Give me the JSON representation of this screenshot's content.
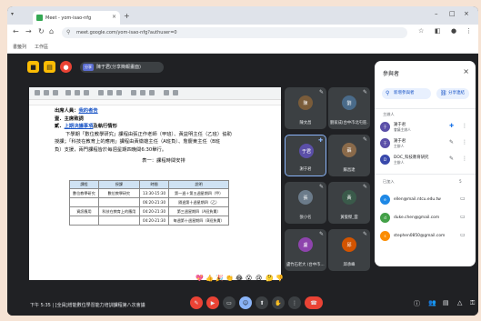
{
  "browser": {
    "tab_title": "Meet - yom-isao-nfg",
    "tab_close": "×",
    "new_tab": "+",
    "url": "meet.google.com/yom-isao-nfg?authuser=0",
    "bookmarks": [
      "書籤列",
      "工作區"
    ],
    "window_controls": [
      "–",
      "□",
      "×"
    ]
  },
  "meet": {
    "presenter_label": "陳于君(分享簡報畫面)",
    "presenter_tag": "分享",
    "bottom_info": "下午 5:35 | [全員]增能數位學習能力培訓課程第八次會議",
    "reactions": [
      "💖",
      "👍",
      "🎉",
      "👏",
      "😂",
      "😮",
      "😢",
      "🤔",
      "👎"
    ],
    "tiles": [
      {
        "name": "陳文昌",
        "initial": "陳",
        "color": "#7a5c3a"
      },
      {
        "name": "劉家成(台中市北屯區…)",
        "initial": "劉",
        "color": "#4a6b8a"
      },
      {
        "name": "謝于君",
        "initial": "于君",
        "color": "#5b4fa8"
      },
      {
        "name": "蘇昌達",
        "initial": "蘇",
        "color": "#8a6a4a"
      },
      {
        "name": "張小名",
        "initial": "張",
        "color": "#6b7b8a"
      },
      {
        "name": "黃俊傑_雲",
        "initial": "黃",
        "color": "#3a5a4a"
      },
      {
        "name": "盧竹石老大 (台中市…)",
        "initial": "盧",
        "color": "#8e44ad"
      },
      {
        "name": "邱承峰",
        "initial": "邱",
        "color": "#d35400"
      }
    ]
  },
  "doc": {
    "line1_prefix": "出席人員：",
    "line1_link": "我的者告",
    "line2": "壹．主席致詞",
    "line3_prefix": "貳．",
    "line3_link": "上期決議事項",
    "line3_suffix": "及執行情形",
    "para": [
      "下學期「數位教學研究」課程由張正作老師（甲班）、黃益明主任（乙班）協助",
      "授課；「科技在教育上的應用」課程由黃徽雄主任（A班負）、詹慶東主任（B班",
      "負）支援，兩門課程皆於每週星期四晚間6:30舉行。"
    ],
    "table_caption": "表一：課程時間安排",
    "table_headers": [
      "課程",
      "授課",
      "時間",
      "說明"
    ],
    "table_rows": [
      [
        "數位教學研究",
        "數位教學研究",
        "13:30-15:30",
        "第一週＋第五週星期四（甲）"
      ],
      [
        "",
        "",
        "06:20-21:30",
        "隔週第十週星期四（乙）"
      ],
      [
        "資訊應用",
        "科技在教育上的應用",
        "04:20-21:30",
        "第三週星期四（A班負責）"
      ],
      [
        "",
        "",
        "04:20-21:30",
        "每週第十週星期四（B班負責）"
      ]
    ]
  },
  "side": {
    "title": "參與者",
    "close": "×",
    "add_label": "新增參與者",
    "share_label": "分享連結",
    "host_label": "主辦人",
    "guests_label": "已加入",
    "guests_count": "5",
    "hosts": [
      {
        "name": "謝于君",
        "sub": "會議主辦人",
        "initial": "于",
        "color": "#5b4fa8"
      },
      {
        "name": "謝于君",
        "sub": "主辦人",
        "initial": "于",
        "color": "#5b4fa8"
      },
      {
        "name": "DOC_科技教育研究",
        "sub": "主辦人",
        "initial": "D",
        "color": "#3949ab"
      }
    ],
    "guests": [
      {
        "name": "ellen@mail.ntcu.edu.tw",
        "initial": "e",
        "color": "#1e88e5"
      },
      {
        "name": "duke.chen@gmail.com",
        "initial": "d",
        "color": "#43a047"
      },
      {
        "name": "stephen0850@gmail.com",
        "initial": "s",
        "color": "#fb8c00"
      }
    ]
  }
}
